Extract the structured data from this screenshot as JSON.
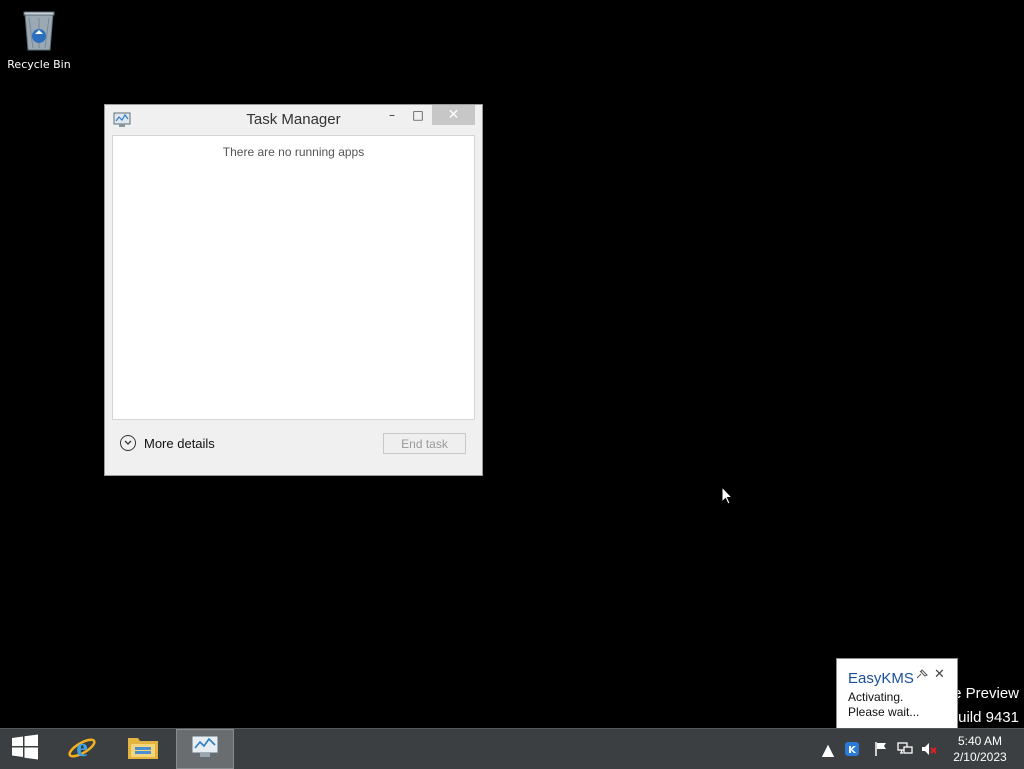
{
  "desktop": {
    "icons": [
      {
        "label": "Recycle Bin",
        "icon": "recycle-bin-icon"
      }
    ],
    "watermark": {
      "line1": "Win                    e Preview",
      "line2": "uild 9431"
    }
  },
  "task_manager": {
    "title": "Task Manager",
    "empty_message": "There are no running apps",
    "more_details_label": "More details",
    "end_task_label": "End task",
    "controls": {
      "minimize": "–",
      "maximize": "□",
      "close": "✕"
    }
  },
  "notification": {
    "title": "EasyKMS",
    "line1": "Activating.",
    "line2": "Please wait...",
    "close": "✕"
  },
  "taskbar": {
    "pinned": [
      "start-button",
      "internet-explorer",
      "file-explorer",
      "task-manager"
    ],
    "active": "task-manager",
    "tray_expand": "▲",
    "clock": {
      "time": "5:40 AM",
      "date": "2/10/2023"
    }
  },
  "colors": {
    "desktop": "#000000",
    "taskbar": "#3b3f41",
    "window_frame": "#f0f0f0",
    "close_button": "#c7c7c7",
    "balloon_title": "#1b4f9c"
  }
}
